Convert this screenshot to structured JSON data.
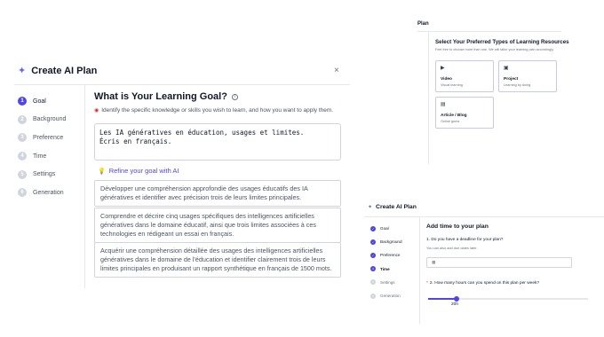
{
  "main": {
    "title": "Create AI Plan",
    "close_glyph": "×",
    "steps": [
      {
        "num": "1",
        "label": "Goal"
      },
      {
        "num": "2",
        "label": "Background"
      },
      {
        "num": "3",
        "label": "Preference"
      },
      {
        "num": "4",
        "label": "Time"
      },
      {
        "num": "5",
        "label": "Settings"
      },
      {
        "num": "6",
        "label": "Generation"
      }
    ],
    "active_step": 0,
    "question": "What is Your Learning Goal?",
    "subtitle": "Identify the specific knowledge or skills you wish to learn, and how you want to apply them.",
    "goal_value": "Les IA génératives en éducation, usages et limites.\nÉcris en français.",
    "refine_label": "Refine your goal with AI",
    "suggestions": [
      "Développer une compréhension approfondie des usages éducatifs des IA génératives et identifier avec précision trois de leurs limites principales.",
      "Comprendre et décrire cinq usages spécifiques des intelligences artificielles génératives dans le domaine éducatif, ainsi que trois limites associées à ces technologies en rédigeant un essai en français.",
      "Acquérir une compréhension détaillée des usages des intelligences artificielles génératives dans le domaine de l'éducation et identifier clairement trois de leurs limites principales en produisant un rapport synthétique en français de 1500 mots."
    ]
  },
  "top_right": {
    "header": "Plan",
    "title": "Select Your Preferred Types of Learning Resources",
    "subtitle": "Feel free to choose more than one. We will tailor your learning plan accordingly.",
    "cards": [
      {
        "icon": "video-icon",
        "glyph": "▶",
        "title": "Video",
        "sub": "Visual learning"
      },
      {
        "icon": "project-icon",
        "glyph": "▣",
        "title": "Project",
        "sub": "Learning by doing"
      },
      {
        "icon": "article-icon",
        "glyph": "▤",
        "title": "Article / Blog",
        "sub": "Online gems"
      }
    ]
  },
  "bottom_right": {
    "title": "Create AI Plan",
    "steps": [
      {
        "num": "1",
        "label": "Goal",
        "state": "done"
      },
      {
        "num": "2",
        "label": "Background",
        "state": "done"
      },
      {
        "num": "3",
        "label": "Preference",
        "state": "done"
      },
      {
        "num": "4",
        "label": "Time",
        "state": "active"
      },
      {
        "num": "5",
        "label": "Settings",
        "state": "todo"
      },
      {
        "num": "6",
        "label": "Generation",
        "state": "todo"
      }
    ],
    "heading": "Add time to your plan",
    "q1": "1. Do you have a deadline for your plan?",
    "q1_sub": "You can also add due dates later.",
    "date_placeholder": "",
    "q2": "2. How many hours can you spend on this plan per week?",
    "slider_value_label": "20h",
    "slider_fraction": 0.18
  },
  "colors": {
    "accent": "#4f46e5"
  }
}
